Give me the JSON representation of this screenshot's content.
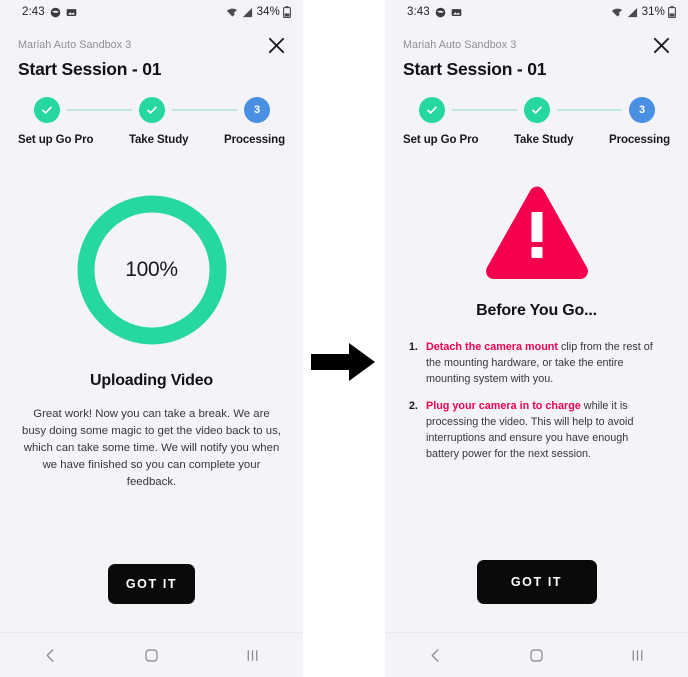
{
  "screens": {
    "left": {
      "status_bar": {
        "time": "2:43",
        "battery_percent": "34%",
        "icons": [
          "camera-icon",
          "gallery-icon",
          "wifi-icon",
          "signal-icon",
          "battery-icon"
        ]
      },
      "header": {
        "subtitle": "Mariah Auto Sandbox 3",
        "title": "Start Session - 01",
        "close_label": "×"
      },
      "stepper": {
        "steps": [
          {
            "label": "Set up Go Pro",
            "state": "done",
            "marker": "✓"
          },
          {
            "label": "Take Study",
            "state": "done",
            "marker": "✓"
          },
          {
            "label": "Processing",
            "state": "active",
            "marker": "3"
          }
        ]
      },
      "progress": {
        "percent_label": "100%",
        "percent_value": 100,
        "ring_color": "#26d7a2",
        "track_color": "#f4f4f8"
      },
      "heading": "Uploading Video",
      "body": "Great work! Now you can take a break. We are busy doing some magic to get the video back to us, which can take some time. We will notify you when we have finished so you can complete your feedback.",
      "primary_button": "GOT IT",
      "nav_bar": {
        "back": "back-icon",
        "home": "home-icon",
        "recents": "recents-icon"
      }
    },
    "right": {
      "status_bar": {
        "time": "3:43",
        "battery_percent": "31%",
        "icons": [
          "camera-icon",
          "gallery-icon",
          "wifi-icon",
          "signal-icon",
          "battery-icon"
        ]
      },
      "header": {
        "subtitle": "Mariah Auto Sandbox 3",
        "title": "Start Session - 01",
        "close_label": "×"
      },
      "stepper": {
        "steps": [
          {
            "label": "Set up Go Pro",
            "state": "done",
            "marker": "✓"
          },
          {
            "label": "Take Study",
            "state": "done",
            "marker": "✓"
          },
          {
            "label": "Processing",
            "state": "active",
            "marker": "3"
          }
        ]
      },
      "warning": {
        "icon": "warning-triangle-icon",
        "color": "#f5004f"
      },
      "heading": "Before You Go...",
      "list": [
        {
          "number": "1.",
          "accent": "Detach the camera mount",
          "rest": " clip from the rest of the mounting hardware, or take the entire mounting system with you."
        },
        {
          "number": "2.",
          "accent": "Plug your camera in to charge",
          "rest": " while it is processing the video. This will help to avoid interruptions and ensure you have enough battery power for the next session."
        }
      ],
      "primary_button": "GOT IT",
      "nav_bar": {
        "back": "back-icon",
        "home": "home-icon",
        "recents": "recents-icon"
      }
    }
  },
  "transition": {
    "arrow_icon": "right-arrow-icon"
  },
  "colors": {
    "accent_green": "#26d7a2",
    "accent_blue": "#4a90e2",
    "accent_red": "#f5004f",
    "button_black": "#0a0a0a",
    "background": "#f4f4f8"
  }
}
